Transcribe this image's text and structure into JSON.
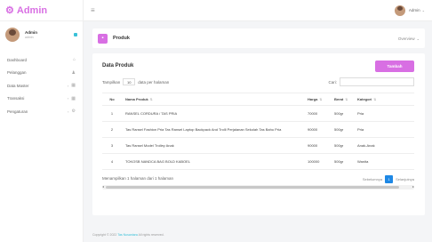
{
  "brand": {
    "name": "Admin",
    "icon": "gear-icon"
  },
  "user": {
    "name": "Admin",
    "role": "admin"
  },
  "sidebar": {
    "items": [
      {
        "label": "Dashboard",
        "icon": "dashboard-icon",
        "glyph": "⌂",
        "has_chevron": false
      },
      {
        "label": "Pelanggan",
        "icon": "users-icon",
        "glyph": "👥",
        "has_chevron": false
      },
      {
        "label": "Data Master",
        "icon": "grid-icon",
        "glyph": "▦",
        "has_chevron": true
      },
      {
        "label": "Transaksi",
        "icon": "grid-icon",
        "glyph": "▦",
        "has_chevron": true
      },
      {
        "label": "Pengaturan",
        "icon": "gears-icon",
        "glyph": "⚙",
        "has_chevron": true
      }
    ]
  },
  "topbar": {
    "user_label": "Admin"
  },
  "page": {
    "title": "Produk",
    "breadcrumb": "Overview"
  },
  "card": {
    "title": "Data Produk",
    "add_button": "Tambah",
    "length_prefix": "Tampilkan",
    "length_value": "10",
    "length_suffix": "data per halaman",
    "search_label": "Cari:"
  },
  "table": {
    "columns": [
      "No",
      "Nama Produk",
      "Harga",
      "Berat",
      "Kategori"
    ],
    "rows": [
      {
        "no": "1",
        "nama": "RANSEL CORDURA / TAS PRIA",
        "harga": "70000",
        "berat": "500gr",
        "kategori": "Pria"
      },
      {
        "no": "2",
        "nama": "Tas Ransel Fashion Pria Tas Ransel Laptop Backpack And Trolli Perjalanan Sekolah Tas Bahu Pria",
        "harga": "90000",
        "berat": "500gr",
        "kategori": "Pria"
      },
      {
        "no": "3",
        "nama": "Tas Ransel Model Trolley Anak",
        "harga": "90000",
        "berat": "500gr",
        "kategori": "Anak-Anak"
      },
      {
        "no": "4",
        "nama": "TOKOSB NANDCA BAG BOLD KABOEL",
        "harga": "100000",
        "berat": "500gr",
        "kategori": "Wanita"
      }
    ]
  },
  "info_text": "Menampilkan 1 halaman dari 1 halaman",
  "pager": {
    "prev": "Sebelumnya",
    "current": "1",
    "next": "Selanjutnya"
  },
  "footer": {
    "prefix": "Copyright © 2022",
    "brand": "Tas Nusantara",
    "suffix": "All rights reserved."
  },
  "colors": {
    "accent": "#d86fe3",
    "link": "#3ac1d8",
    "pager_active": "#1e88e5"
  }
}
